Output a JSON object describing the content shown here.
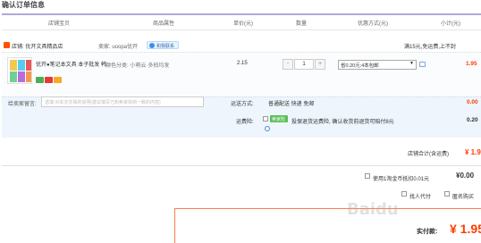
{
  "page": {
    "title": "确认订单信息"
  },
  "columns": [
    "店铺宝贝",
    "商品属性",
    "单价(元)",
    "数量",
    "优惠方式(元)",
    "小计(元)"
  ],
  "shop": {
    "name_label": "店铺: 优开文具精品店",
    "seller_label": "卖家: uoopa优开",
    "contact_label": "和我联系",
    "free_shipping_note": "满15元,免运费,上不封"
  },
  "item": {
    "title_line1": "优开●笔记本文具 本子批发 韩...",
    "title_line2": "",
    "spec": "颜色分类: 小萌云·多拍均发",
    "unit_price": "2.15",
    "quantity": "1",
    "qty_minus": "-",
    "qty_plus": "+",
    "promo": "省0.20元:4本包邮",
    "subtotal": "1.95"
  },
  "message": {
    "label": "给卖家留言:",
    "placeholder": "选填:对本次交易的说明(建议填写已和卖家协商一致的内容)"
  },
  "shipping": {
    "label": "运送方式:",
    "value": "普通配送 快递 免邮",
    "fee": "0.00"
  },
  "insurance": {
    "label": "运费险:",
    "tag": "卖家险",
    "text": "投保退货运费险, 确认收货前退货可赔付8元",
    "fee": "0.20"
  },
  "store_total": {
    "label": "店铺合计(含运费)",
    "value": "¥ 1.95"
  },
  "coins": {
    "label": "使用1淘金币抵扣0.01元",
    "value": "¥0.00"
  },
  "options": {
    "anon_pay_label": "找人代付",
    "anon_buy_label": "匿名购买"
  },
  "payable": {
    "label": "实付款:",
    "value": "¥ 1.95"
  },
  "colors": {
    "accent_orange": "#ff3c00",
    "shop_icon": "#ff5000",
    "header_line": "#b4a7d6",
    "note_bg": "#eef5fc"
  },
  "icons": {
    "shop": "shop-icon",
    "contact": "chat-icon",
    "promo_help": "help-icon",
    "insurance_info": "info-icon",
    "dropdown": "chevron-down-icon"
  }
}
